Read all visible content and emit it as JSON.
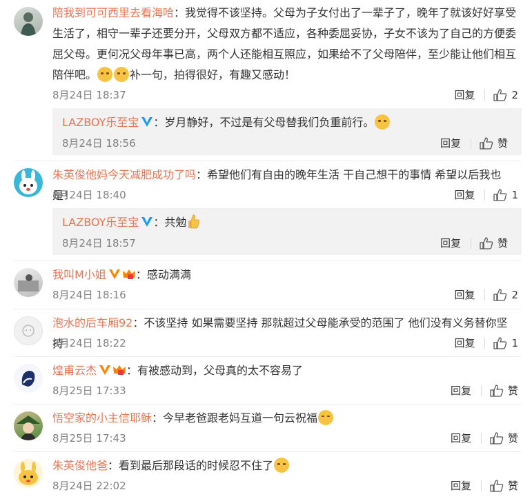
{
  "ui": {
    "reply": "回复",
    "like": "赞"
  },
  "comments": [
    {
      "user": "陪我到可可西里去看海哈",
      "text": "：我觉得不该坚持。父母为子女付出了一辈子了，晚年了就该好好享受生活了，相守一辈子还要分开，父母双方都不适应，各种委屈妥协，子女不该为了自己的方便委屈父母。更何况父母年事已高，两个人还能相互照应，如果给不了父母陪伴，至少能让他们相互陪伴吧。",
      "text2": "补一句，拍得很好，有趣又感动！",
      "emoji": [
        "face-crying-icon",
        "face-crying-icon"
      ],
      "time": "8月24日 18:37",
      "likes": "2",
      "reply": {
        "user": "LAZBOY乐至宝",
        "text": "：岁月静好，不过是有父母替我们负重前行。",
        "emoji": "face-crying-icon",
        "time": "8月24日 18:56"
      }
    },
    {
      "user": "朱英俊他妈今天减肥成功了吗",
      "text": "：希望他们有自由的晚年生活 干自己想干的事情 希望以后我也是！",
      "time": "8月24日 18:40",
      "likes": "1",
      "reply": {
        "user": "LAZBOY乐至宝",
        "text": "：共勉",
        "emoji": "thumbs-up-emoji",
        "time": "8月24日 18:57"
      }
    },
    {
      "user": "我叫M小姐",
      "text": "：感动满满",
      "time": "8月24日 18:16",
      "likes": "2"
    },
    {
      "user": "泡水的后车厢92",
      "text": "：不该坚持 如果需要坚持 那就超过父母能承受的范围了 他们没有义务替你坚持",
      "time": "8月24日 18:22",
      "likes": "1"
    },
    {
      "user": "煌甫云杰",
      "text": "：有被感动到，父母真的太不容易了",
      "time": "8月25日 17:33",
      "likes": ""
    },
    {
      "user": "悟空家的小主信耶稣",
      "text": "：今早老爸跟老妈互道一句云祝福",
      "emoji": "face-laughing-icon",
      "time": "8月25日 17:43",
      "likes": ""
    },
    {
      "user": "朱英俊他爸",
      "text": "：看到最后那段话的时候忍不住了",
      "emoji": "face-crying-icon",
      "time": "8月24日 22:02",
      "likes": ""
    }
  ],
  "colors": {
    "username": "#eb7350",
    "time": "#808080",
    "reply_bg": "#f2f2f2",
    "verified": "#1d9bf0",
    "vip": "#ff8200"
  }
}
